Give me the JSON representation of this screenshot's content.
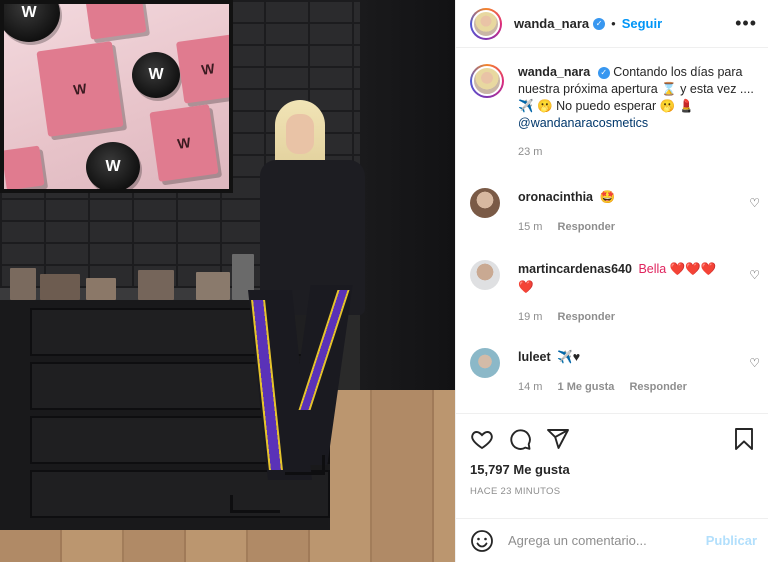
{
  "post": {
    "username": "wanda_nara",
    "follow_label": "Seguir",
    "dot": "•",
    "more": "•••"
  },
  "caption": {
    "username": "wanda_nara",
    "text": "Contando los días para nuestra próxima apertura ⌛ y esta vez .... ✈️ 🫢 No puedo esperar 🫢 💄",
    "mention": "@wandanaracosmetics",
    "age": "23 m"
  },
  "comments": [
    {
      "username": "oronacinthia",
      "text": "🤩",
      "age": "15 m",
      "likes": "",
      "reply": "Responder"
    },
    {
      "username": "martincardenas640",
      "text": "Bella ❤️❤️❤️❤️",
      "age": "19 m",
      "likes": "",
      "reply": "Responder"
    },
    {
      "username": "luleet",
      "text": "✈️♥",
      "age": "14 m",
      "likes": "1 Me gusta",
      "reply": "Responder"
    }
  ],
  "actions": {
    "likes": "15,797 Me gusta",
    "time": "HACE 23 MINUTOS"
  },
  "add_comment": {
    "placeholder": "Agrega un comentario...",
    "publish": "Publicar"
  },
  "photo": {
    "brand_mark": "W"
  }
}
